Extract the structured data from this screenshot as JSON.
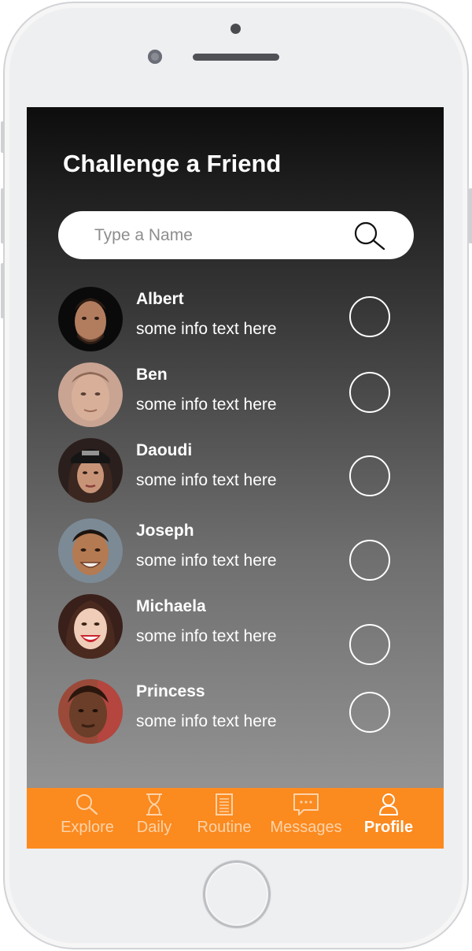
{
  "screen": {
    "title": "Challenge a Friend"
  },
  "search": {
    "placeholder": "Type a Name",
    "icon": "search-icon"
  },
  "friends": [
    {
      "name": "Albert",
      "info": "some info text here"
    },
    {
      "name": "Ben",
      "info": "some info text here"
    },
    {
      "name": "Daoudi",
      "info": "some info text here"
    },
    {
      "name": "Joseph",
      "info": "some info text here"
    },
    {
      "name": "Michaela",
      "info": "some info text here"
    },
    {
      "name": "Princess",
      "info": "some info text here"
    }
  ],
  "tabbar": {
    "tabs": [
      {
        "label": "Explore",
        "icon": "search-icon"
      },
      {
        "label": "Daily",
        "icon": "hourglass-icon"
      },
      {
        "label": "Routine",
        "icon": "clipboard-icon"
      },
      {
        "label": "Messages",
        "icon": "chat-icon"
      },
      {
        "label": "Profile",
        "icon": "user-icon"
      }
    ],
    "active": "Profile"
  },
  "colors": {
    "accent": "#fb8a1f",
    "tab_inactive": "#fdd3a9",
    "tab_active": "#ffffff",
    "background_top": "#0d0d0d",
    "background_bottom": "#9c9c9c"
  }
}
